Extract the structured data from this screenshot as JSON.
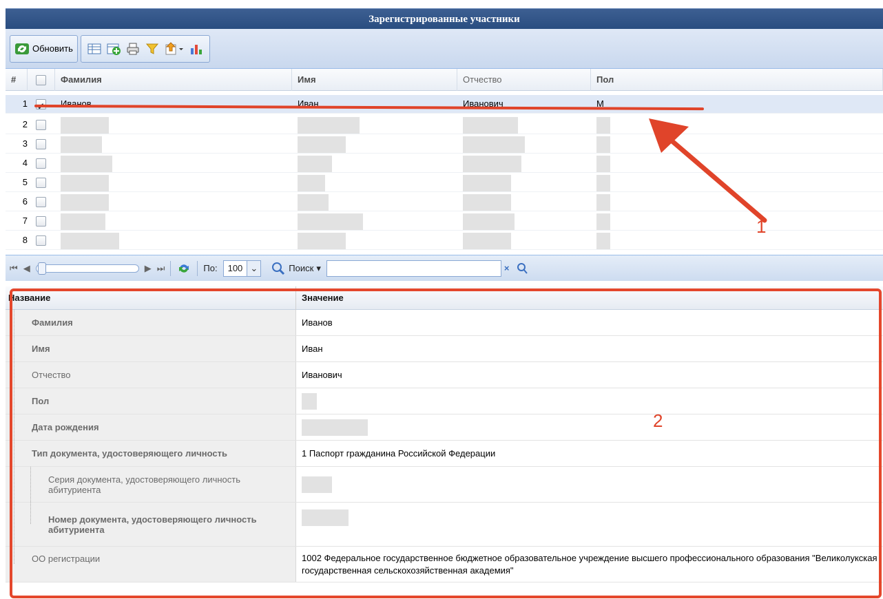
{
  "window": {
    "title": "Зарегистрированные участники"
  },
  "toolbar": {
    "refresh_label": "Обновить"
  },
  "grid": {
    "columns": [
      "#",
      "",
      "Фамилия",
      "Имя",
      "Отчество",
      "Пол"
    ],
    "rows": [
      {
        "num": "1",
        "checked": true,
        "last": "Иванов",
        "first": "Иван",
        "middle": "Иванович",
        "gender": "М"
      },
      {
        "num": "2",
        "checked": false
      },
      {
        "num": "3",
        "checked": false
      },
      {
        "num": "4",
        "checked": false
      },
      {
        "num": "5",
        "checked": false
      },
      {
        "num": "6",
        "checked": false
      },
      {
        "num": "7",
        "checked": false
      },
      {
        "num": "8",
        "checked": false
      }
    ]
  },
  "pager": {
    "per_page_label": "По:",
    "per_page_value": "100",
    "search_label": "Поиск",
    "search_value": ""
  },
  "props": {
    "col_name": "Название",
    "col_value": "Значение",
    "rows": [
      {
        "name": "Фамилия",
        "value": "Иванов"
      },
      {
        "name": "Имя",
        "value": "Иван"
      },
      {
        "name": "Отчество",
        "value": "Иванович"
      },
      {
        "name": "Пол",
        "value": ""
      },
      {
        "name": "Дата рождения",
        "value": ""
      },
      {
        "name": "Тип документа, удостоверяющего личность",
        "value": "1 Паспорт гражданина Российской Федерации"
      },
      {
        "name": "Серия документа, удостоверяющего личность абитуриента",
        "value": ""
      },
      {
        "name": "Номер документа, удостоверяющего личность абитуриента",
        "value": ""
      },
      {
        "name": "ОО регистрации",
        "value": "1002 Федеральное государственное бюджетное образовательное учреждение высшего профессионального образования \"Великолукская государственная сельскохозяйственная академия\""
      }
    ]
  },
  "annotations": {
    "one": "1",
    "two": "2"
  },
  "colors": {
    "accent": "#294d80",
    "annotation": "#e0442a",
    "selection": "#dfe8f6"
  }
}
